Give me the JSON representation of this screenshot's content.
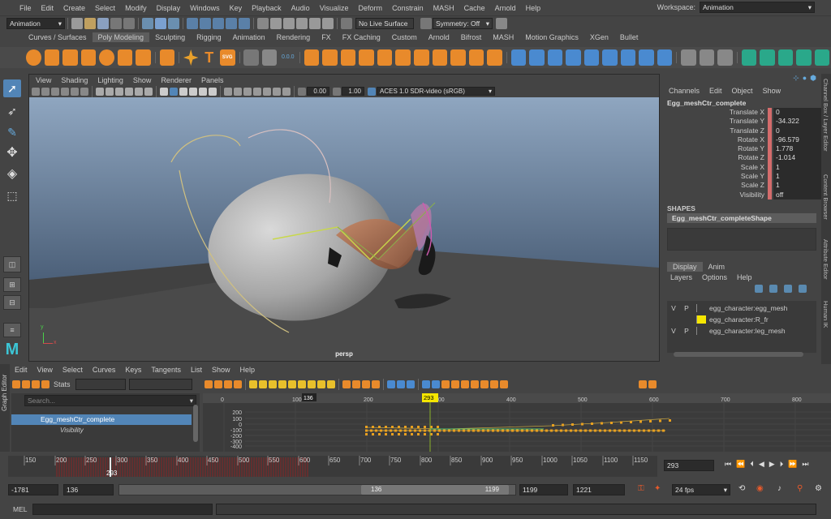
{
  "menubar": {
    "items": [
      "File",
      "Edit",
      "Create",
      "Select",
      "Modify",
      "Display",
      "Windows",
      "Key",
      "Playback",
      "Audio",
      "Visualize",
      "Deform",
      "Constrain",
      "MASH",
      "Cache",
      "Arnold",
      "Help"
    ],
    "workspace_label": "Workspace:",
    "workspace_value": "Animation"
  },
  "statusline": {
    "menuset": "Animation",
    "live_surface": "No Live Surface",
    "symmetry": "Symmetry: Off"
  },
  "shelf": {
    "tabs": [
      "Curves / Surfaces",
      "Poly Modeling",
      "Sculpting",
      "Rigging",
      "Animation",
      "Rendering",
      "FX",
      "FX Caching",
      "Custom",
      "Arnold",
      "Bifrost",
      "MASH",
      "Motion Graphics",
      "XGen",
      "Bullet"
    ],
    "active": 1,
    "text_icon": "T",
    "svg_icon": "SVG",
    "counter": "0.0.0"
  },
  "viewport": {
    "menus": [
      "View",
      "Shading",
      "Lighting",
      "Show",
      "Renderer",
      "Panels"
    ],
    "exposure": "0.00",
    "gamma": "1.00",
    "colorspace": "ACES 1.0 SDR-video (sRGB)",
    "camera_label": "persp",
    "axis_y": "y",
    "axis_x": "x"
  },
  "channelbox": {
    "menus": [
      "Channels",
      "Edit",
      "Object",
      "Show"
    ],
    "object": "Egg_meshCtr_complete",
    "channels": [
      {
        "label": "Translate X",
        "value": "0"
      },
      {
        "label": "Translate Y",
        "value": "-34.322"
      },
      {
        "label": "Translate Z",
        "value": "0"
      },
      {
        "label": "Rotate X",
        "value": "-96.579"
      },
      {
        "label": "Rotate Y",
        "value": "1.778"
      },
      {
        "label": "Rotate Z",
        "value": "-1.014"
      },
      {
        "label": "Scale X",
        "value": "1"
      },
      {
        "label": "Scale Y",
        "value": "1"
      },
      {
        "label": "Scale Z",
        "value": "1"
      },
      {
        "label": "Visibility",
        "value": "off"
      }
    ],
    "shapes_header": "SHAPES",
    "shape": "Egg_meshCtr_completeShape"
  },
  "layers": {
    "tabs": [
      "Display",
      "Anim"
    ],
    "menus": [
      "Layers",
      "Options",
      "Help"
    ],
    "rows": [
      {
        "v": "V",
        "p": "P",
        "name": "egg_character:egg_mesh",
        "color": ""
      },
      {
        "v": "",
        "p": "",
        "name": "egg_character:R_fr",
        "color": "#f5e600"
      },
      {
        "v": "V",
        "p": "P",
        "name": "egg_character:leg_mesh",
        "color": ""
      }
    ]
  },
  "side_tabs": [
    "Channel Box / Layer Editor",
    "Content Browser",
    "Attribute Editor",
    "Human IK"
  ],
  "graph": {
    "side_label": "Graph Editor",
    "menus": [
      "Edit",
      "View",
      "Select",
      "Curves",
      "Keys",
      "Tangents",
      "List",
      "Show",
      "Help"
    ],
    "stats_label": "Stats",
    "search_placeholder": "Search...",
    "outliner_item": "Egg_meshCtr_complete",
    "outliner_sub": "Visibility",
    "ruler": [
      "0",
      "100",
      "200",
      "300",
      "400",
      "500",
      "600",
      "700",
      "800"
    ],
    "y_ticks": [
      "200",
      "100",
      "0",
      "-100",
      "-200",
      "-300",
      "-400"
    ],
    "current_frame": "293",
    "range_marker": "136"
  },
  "timeslider": {
    "ticks": [
      "150",
      "200",
      "250",
      "300",
      "350",
      "400",
      "450",
      "500",
      "550",
      "600",
      "650",
      "700",
      "750",
      "800",
      "850",
      "900",
      "950",
      "1000",
      "1050",
      "1100",
      "1150"
    ],
    "current_frame_label": "293",
    "frame_field": "293"
  },
  "rangeslider": {
    "start": "-1781",
    "playback_start": "136",
    "range_start": "136",
    "range_end": "1199",
    "playback_end": "1199",
    "end": "1221",
    "fps": "24 fps"
  },
  "commandline": {
    "label": "MEL"
  }
}
